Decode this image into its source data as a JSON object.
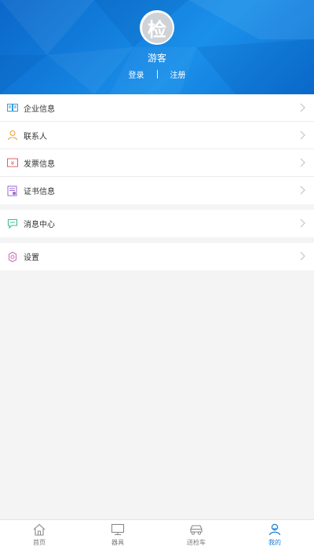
{
  "header": {
    "avatar_char": "检",
    "username": "游客",
    "login_label": "登录",
    "register_label": "注册"
  },
  "menu": {
    "group1": [
      {
        "label": "企业信息",
        "icon": "building-info-icon"
      },
      {
        "label": "联系人",
        "icon": "person-icon"
      },
      {
        "label": "发票信息",
        "icon": "invoice-icon"
      },
      {
        "label": "证书信息",
        "icon": "certificate-icon"
      }
    ],
    "group2": [
      {
        "label": "消息中心",
        "icon": "message-icon"
      }
    ],
    "group3": [
      {
        "label": "设置",
        "icon": "settings-gear-icon"
      }
    ]
  },
  "tabbar": {
    "tabs": [
      {
        "label": "首页",
        "icon": "home-icon"
      },
      {
        "label": "器具",
        "icon": "monitor-icon"
      },
      {
        "label": "送检车",
        "icon": "car-icon"
      },
      {
        "label": "我的",
        "icon": "user-icon"
      }
    ],
    "active_index": 3
  },
  "colors": {
    "header_blue": "#137fdd",
    "active_tab": "#1a7fd6",
    "icon_blue": "#3a9ad9",
    "icon_orange": "#f0a030",
    "icon_red": "#e06060",
    "icon_purple": "#9a6ad0",
    "icon_green": "#3cc08a",
    "icon_pink": "#d070c0"
  }
}
